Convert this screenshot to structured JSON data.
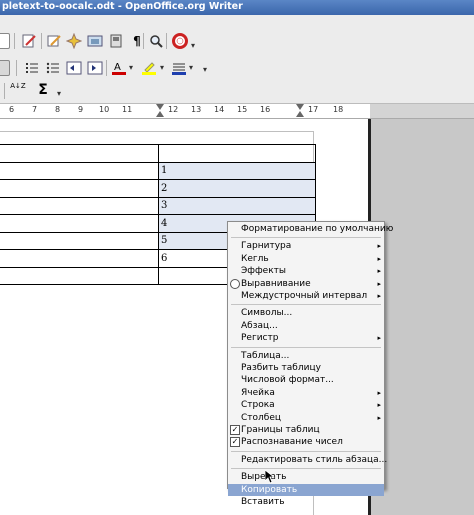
{
  "window": {
    "title": "pletext-to-oocalc.odt - OpenOffice.org Writer"
  },
  "toolbar": {
    "standard_icons": [
      "new-doc",
      "edit-file",
      "pdf-export",
      "print",
      "page-preview",
      "paragraph-marks",
      "find",
      "help"
    ],
    "sigma": "Σ",
    "sort_label": "A↓Z"
  },
  "ruler": {
    "numbers": [
      "6",
      "7",
      "8",
      "9",
      "10",
      "11",
      "12",
      "13",
      "14",
      "15",
      "16",
      "17",
      "18"
    ]
  },
  "table": {
    "rows": [
      [
        "",
        ""
      ],
      [
        "",
        "1"
      ],
      [
        "",
        "2"
      ],
      [
        "",
        "3"
      ],
      [
        "",
        "4"
      ],
      [
        "",
        "5"
      ],
      [
        "",
        "6"
      ],
      [
        "",
        ""
      ]
    ]
  },
  "context_menu": {
    "items": [
      {
        "label": "Форматирование по умолчанию"
      },
      {
        "sep": true
      },
      {
        "label": "Гарнитура",
        "submenu": true
      },
      {
        "label": "Кегль",
        "submenu": true
      },
      {
        "label": "Эффекты",
        "submenu": true
      },
      {
        "label": "Выравнивание",
        "submenu": true,
        "radio": true
      },
      {
        "label": "Междустрочный интервал",
        "submenu": true
      },
      {
        "sep": true
      },
      {
        "label": "Символы..."
      },
      {
        "label": "Абзац..."
      },
      {
        "label": "Регистр",
        "submenu": true
      },
      {
        "sep": true
      },
      {
        "label": "Таблица..."
      },
      {
        "label": "Разбить таблицу"
      },
      {
        "label": "Числовой формат..."
      },
      {
        "label": "Ячейка",
        "submenu": true
      },
      {
        "label": "Строка",
        "submenu": true
      },
      {
        "label": "Столбец",
        "submenu": true
      },
      {
        "label": "Границы таблиц",
        "checked": true
      },
      {
        "label": "Распознавание чисел",
        "checked": true
      },
      {
        "sep": true
      },
      {
        "label": "Редактировать стиль абзаца..."
      },
      {
        "sep": true
      },
      {
        "label": "Вырезать"
      },
      {
        "label": "Копировать",
        "highlighted": true
      },
      {
        "label": "Вставить"
      }
    ]
  },
  "colors": {
    "highlight": "#8aa5d1",
    "selected_cell": "#e2e8f3"
  }
}
